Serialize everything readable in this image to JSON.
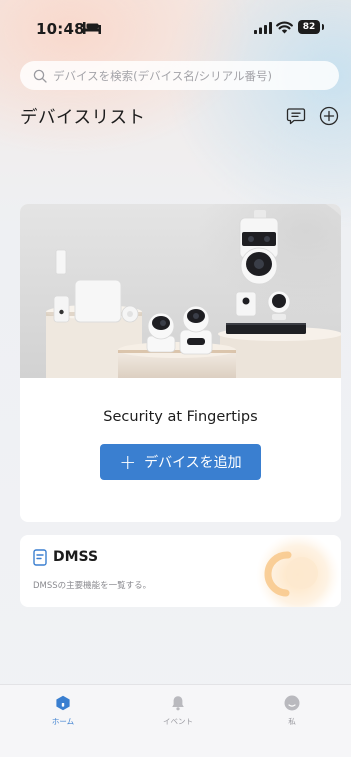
{
  "status_bar": {
    "time": "10:48",
    "battery": "82"
  },
  "search": {
    "placeholder": "デバイスを検索(デバイス名/シリアル番号)"
  },
  "header": {
    "title": "デバイスリスト"
  },
  "device_card": {
    "title": "Security at Fingertips",
    "add_button_label": "デバイスを追加",
    "add_button_icon": "+"
  },
  "dmss_card": {
    "title": "DMSS",
    "description": "DMSSの主要機能を一覧する。"
  },
  "tabs": [
    {
      "label": "ホーム",
      "icon": "home-icon",
      "active": true
    },
    {
      "label": "イベント",
      "icon": "bell-icon",
      "active": false
    },
    {
      "label": "私",
      "icon": "user-icon",
      "active": false
    }
  ],
  "colors": {
    "accent": "#3a7fd0",
    "inactive": "#b9b9be",
    "background": "#f1f2f5"
  }
}
